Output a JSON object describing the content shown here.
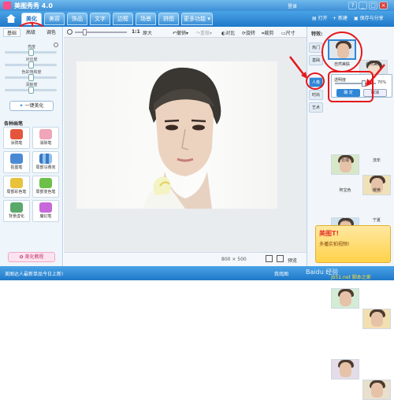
{
  "window": {
    "title": "美图秀秀 4.0",
    "login": "登录",
    "controls": [
      "?",
      "_",
      "□",
      "×"
    ]
  },
  "menu": {
    "tabs": [
      "美化",
      "美容",
      "饰品",
      "文字",
      "边框",
      "场景",
      "拼图"
    ],
    "active_tab": "美化",
    "more": "更多功能",
    "open": "打开",
    "new": "新建",
    "save": "保存与分享"
  },
  "left_panel": {
    "subtabs": [
      "基础",
      "高级",
      "调色"
    ],
    "sliders": [
      {
        "label": "亮度",
        "value": 0.5
      },
      {
        "label": "对比度",
        "value": 0.5
      },
      {
        "label": "色彩饱和度",
        "value": 0.5
      },
      {
        "label": "清晰度",
        "value": 0.5
      }
    ],
    "one_click": "一键美化",
    "brushes_title": "各种画笔",
    "brushes": [
      "涂鸦笔",
      "消除笔",
      "抠图笔",
      "局部马赛克",
      "局部彩色笔",
      "局部变色笔",
      "背景虚化",
      "魔幻笔"
    ],
    "tutorial": "美化教程"
  },
  "toolbar": {
    "zoom": "1:1",
    "original": "原大",
    "rotate": "旋转",
    "crop": "裁剪",
    "resize": "尺寸",
    "undo": "撤销",
    "redo": "重做",
    "compare": "对比"
  },
  "status": {
    "size": "800 × 500",
    "preview": "预览"
  },
  "right_panel": {
    "effects_label": "特效:",
    "categories": [
      "热门",
      "基础",
      "人像",
      "时尚",
      "艺术"
    ],
    "active_category": "人像",
    "top_effects": [
      "自然美肤",
      "自然美白"
    ],
    "opacity_label": "透明度",
    "opacity_value": "70%",
    "confirm": "确 定",
    "cancel": "取消",
    "effects": [
      "",
      "",
      "云端",
      "流年",
      "",
      "",
      "阿宝色",
      "暖黄",
      "",
      "",
      "优格",
      "宁夏"
    ],
    "ad_title": "美图T!",
    "ad_sub": "多播实拍视频!"
  },
  "bottom_bar": {
    "left": "美图达人最新单品今日上新!",
    "right": "我找图",
    "watermark": "Baidu 经验",
    "site": "jb51.net 脚本之家"
  }
}
